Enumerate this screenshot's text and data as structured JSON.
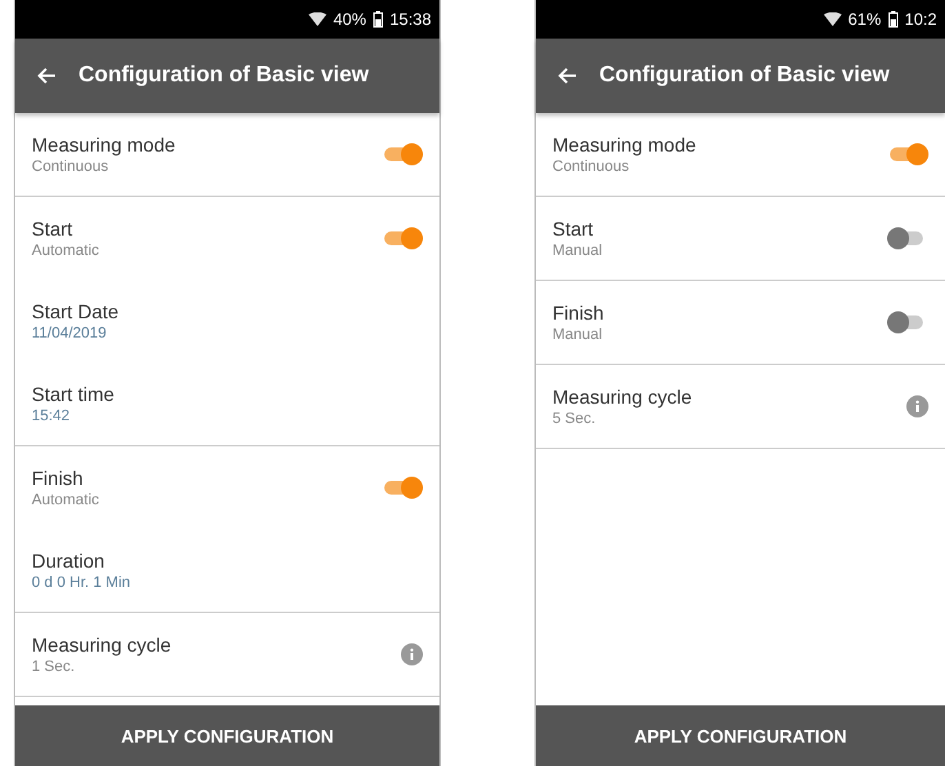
{
  "phones": [
    {
      "status_bar": {
        "battery": "40%",
        "time": "15:38"
      },
      "header": {
        "title": "Configuration of Basic view"
      },
      "sections": [
        [
          {
            "kind": "toggle",
            "label": "Measuring mode",
            "value": "Continuous",
            "on": true
          }
        ],
        [
          {
            "kind": "toggle",
            "label": "Start",
            "value": "Automatic",
            "on": true
          },
          {
            "kind": "field",
            "label": "Start Date",
            "value": "11/04/2019"
          },
          {
            "kind": "field",
            "label": "Start time",
            "value": "15:42"
          }
        ],
        [
          {
            "kind": "toggle",
            "label": "Finish",
            "value": "Automatic",
            "on": true
          },
          {
            "kind": "field",
            "label": "Duration",
            "value": "0 d 0 Hr. 1 Min"
          }
        ],
        [
          {
            "kind": "info",
            "label": "Measuring cycle",
            "value": "1 Sec."
          }
        ]
      ],
      "button": "APPLY CONFIGURATION"
    },
    {
      "status_bar": {
        "battery": "61%",
        "time": "10:2"
      },
      "header": {
        "title": "Configuration of Basic view"
      },
      "sections": [
        [
          {
            "kind": "toggle",
            "label": "Measuring mode",
            "value": "Continuous",
            "on": true
          }
        ],
        [
          {
            "kind": "toggle",
            "label": "Start",
            "value": "Manual",
            "on": false
          }
        ],
        [
          {
            "kind": "toggle",
            "label": "Finish",
            "value": "Manual",
            "on": false
          }
        ],
        [
          {
            "kind": "info",
            "label": "Measuring cycle",
            "value": "5 Sec."
          }
        ]
      ],
      "button": "APPLY CONFIGURATION"
    }
  ]
}
